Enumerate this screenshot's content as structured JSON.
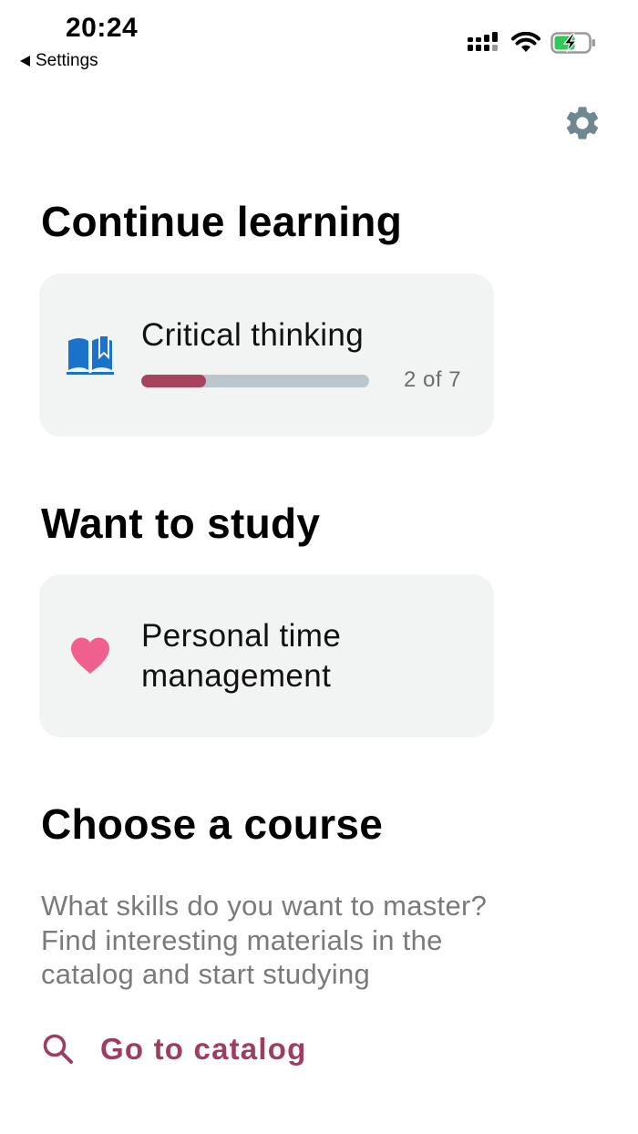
{
  "status_bar": {
    "time": "20:24",
    "back_label": "Settings"
  },
  "colors": {
    "accent": "#9e3d62",
    "progress_fill": "#a8435f",
    "progress_track": "#bac5cc",
    "card_bg": "#f2f3f3",
    "book_icon": "#1a73c8",
    "heart_icon": "#f0608e",
    "gear_icon": "#6f8791"
  },
  "continue_learning": {
    "heading": "Continue learning",
    "course": {
      "icon": "book-icon",
      "title": "Critical thinking",
      "progress_text": "2 of 7",
      "progress_fraction": 0.2857
    }
  },
  "want_to_study": {
    "heading": "Want to study",
    "course": {
      "icon": "heart-icon",
      "title_line1": "Personal time",
      "title_line2": "management"
    }
  },
  "choose_course": {
    "heading": "Choose a course",
    "desc_line1": "What skills do you want to master?",
    "desc_line2": "Find interesting materials in the",
    "desc_line3": "catalog and start studying",
    "link_label": "Go to catalog",
    "link_icon": "search-icon"
  },
  "settings_icon": "gear-icon"
}
